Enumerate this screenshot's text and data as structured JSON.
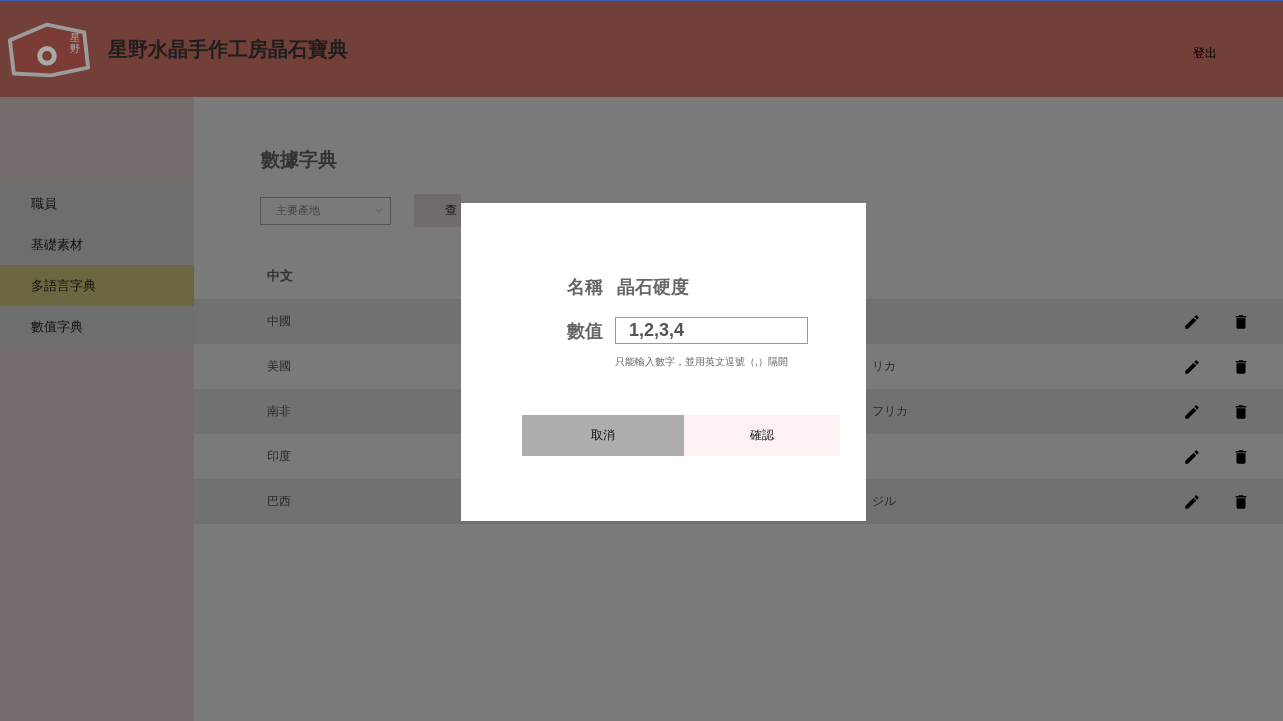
{
  "header": {
    "logo_mark": "星野",
    "title": "星野水晶手作工房晶石寶典",
    "logout": "登出"
  },
  "sidebar": {
    "items": [
      {
        "label": "職員",
        "selected": false
      },
      {
        "label": "基礎素材",
        "selected": false
      },
      {
        "label": "多語言字典",
        "selected": true
      },
      {
        "label": "數值字典",
        "selected": false
      }
    ]
  },
  "page": {
    "title": "數據字典",
    "filter": {
      "value": "主要產地"
    },
    "search_button": "查"
  },
  "table": {
    "columns": [
      "中文"
    ],
    "rows": [
      {
        "column_1": "中國"
      },
      {
        "column_1": "美國",
        "column_3": "リカ"
      },
      {
        "column_1": "南非",
        "column_3": "フリカ"
      },
      {
        "column_1": "印度"
      },
      {
        "column_1": "巴西",
        "column_3": "ジル"
      }
    ]
  },
  "dialog": {
    "name_label": "名稱",
    "name_value": "晶石硬度",
    "value_label": "數值",
    "value": "1,2,3,4",
    "hint": "只能輸入數字，並用英文逗號（,）隔開",
    "buttons": [
      {
        "label": "取消",
        "kind": "cancel"
      },
      {
        "label": "確認",
        "kind": "confirm"
      }
    ]
  }
}
